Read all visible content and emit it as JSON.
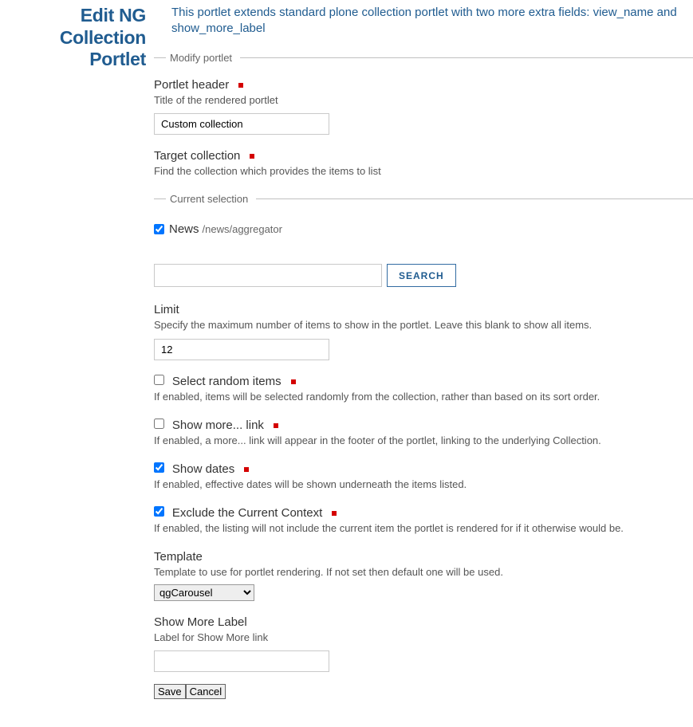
{
  "sidebar": {
    "title": "Edit NG Collection Portlet"
  },
  "description": "This portlet extends standard plone collection portlet with two more extra fields: view_name and show_more_label",
  "fieldset": {
    "legend": "Modify portlet",
    "portlet_header": {
      "label": "Portlet header",
      "help": "Title of the rendered portlet",
      "value": "Custom collection"
    },
    "target_collection": {
      "label": "Target collection",
      "help": "Find the collection which provides the items to list"
    },
    "current_selection": {
      "legend": "Current selection",
      "item_label": "News",
      "item_path": "/news/aggregator",
      "checked": true
    },
    "search": {
      "button": "SEARCH",
      "value": ""
    },
    "limit": {
      "label": "Limit",
      "help": "Specify the maximum number of items to show in the portlet. Leave this blank to show all items.",
      "value": "12"
    },
    "random": {
      "label": "Select random items",
      "help": "If enabled, items will be selected randomly from the collection, rather than based on its sort order.",
      "checked": false
    },
    "show_more": {
      "label": "Show more... link",
      "help": "If enabled, a more... link will appear in the footer of the portlet, linking to the underlying Collection.",
      "checked": false
    },
    "show_dates": {
      "label": "Show dates",
      "help": "If enabled, effective dates will be shown underneath the items listed.",
      "checked": true
    },
    "exclude_context": {
      "label": "Exclude the Current Context",
      "help": "If enabled, the listing will not include the current item the portlet is rendered for if it otherwise would be.",
      "checked": true
    },
    "template": {
      "label": "Template",
      "help": "Template to use for portlet rendering. If not set then default one will be used.",
      "value": "qgCarousel"
    },
    "show_more_label": {
      "label": "Show More Label",
      "help": "Label for Show More link",
      "value": ""
    },
    "buttons": {
      "save": "Save",
      "cancel": "Cancel"
    }
  }
}
